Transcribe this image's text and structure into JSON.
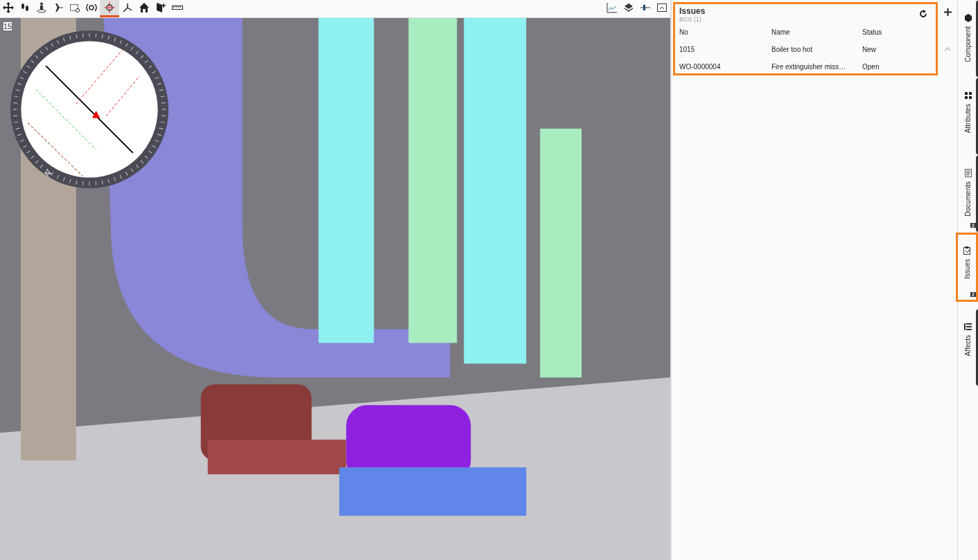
{
  "toolbar": {
    "left_tools": [
      {
        "selected": false
      },
      {
        "selected": false
      },
      {
        "selected": false
      },
      {
        "selected": false
      },
      {
        "selected": false
      },
      {
        "selected": false
      },
      {
        "selected": true
      },
      {
        "selected": false
      },
      {
        "selected": false
      },
      {
        "selected": false
      },
      {
        "selected": false
      }
    ],
    "right_tools": [
      {
        "selected": false
      },
      {
        "selected": false
      },
      {
        "selected": false
      },
      {
        "selected": false
      }
    ]
  },
  "viewport": {
    "frame_rate": "15",
    "compass_label": "N"
  },
  "issues_panel": {
    "title": "Issues",
    "subtitle": "BCS (1)",
    "highlighted": true,
    "columns": [
      "No",
      "Name",
      "Status"
    ],
    "rows": [
      [
        "1015",
        "Boiler too hot",
        "New"
      ],
      [
        "WO-0000004",
        "Fire extinguisher miss…",
        "Open"
      ]
    ]
  },
  "sidebar": {
    "tabs": [
      {
        "label": "Component",
        "selected": false
      },
      {
        "label": "Attributes",
        "selected": false
      },
      {
        "label": "Documents",
        "selected": false,
        "badge": "2"
      },
      {
        "label": "Issues",
        "selected": true,
        "badge": "2"
      },
      {
        "label": "Affects",
        "selected": false
      }
    ]
  }
}
